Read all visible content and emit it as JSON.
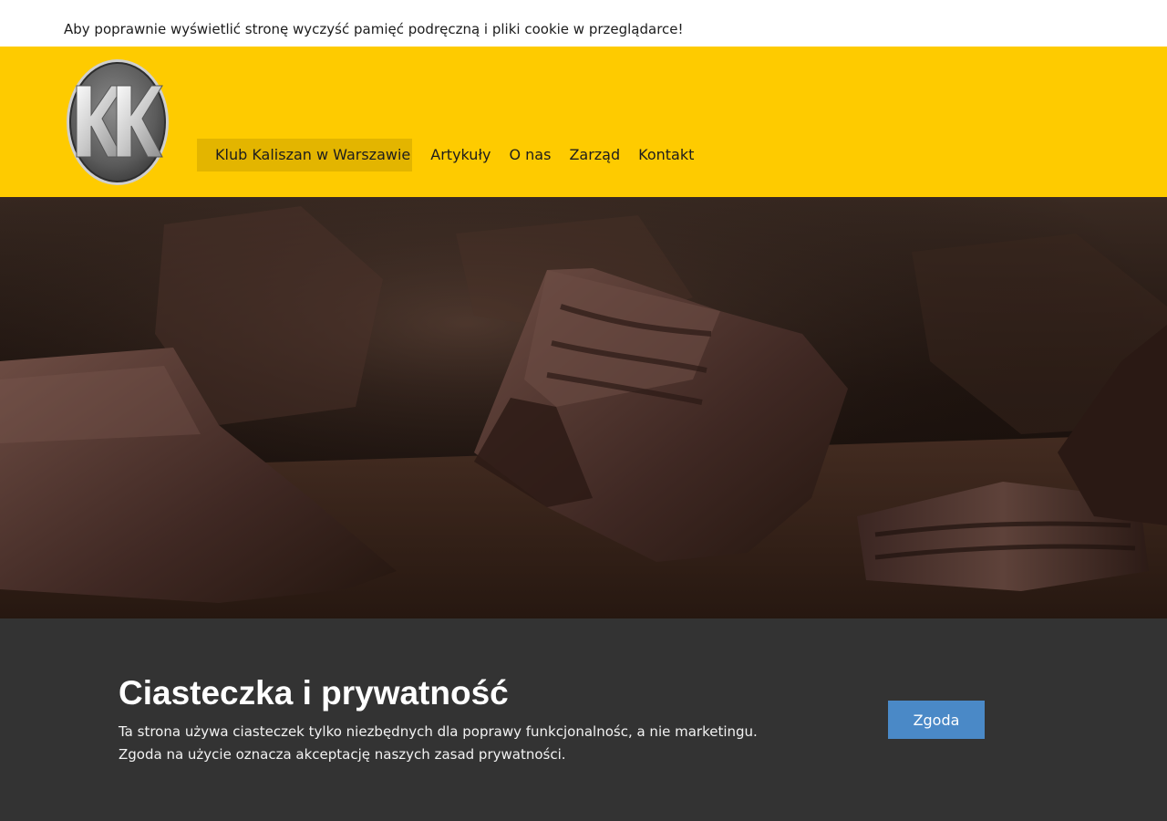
{
  "notice": {
    "text": "Aby poprawnie wyświetlić stronę wyczyść pamięć podręczną i pliki cookie w przeglądarce!"
  },
  "header": {
    "logo_icon": "kk-monogram-logo-icon",
    "nav": [
      {
        "label": "Klub Kaliszan w Warszawie",
        "active": true
      },
      {
        "label": "Artykuły",
        "active": false
      },
      {
        "label": "O nas",
        "active": false
      },
      {
        "label": "Zarząd",
        "active": false
      },
      {
        "label": "Kontakt",
        "active": false
      }
    ]
  },
  "cookie_banner": {
    "title": "Ciasteczka i prywatność",
    "line1": "Ta strona używa ciasteczek tylko niezbędnych dla poprawy funkcjonalnośc, a nie marketingu.",
    "line2": "Zgoda na użycie oznacza akceptację naszych zasad prywatności.",
    "agree_label": "Zgoda"
  },
  "colors": {
    "header_bg": "#fecb00",
    "nav_active_bg": "#e3b500",
    "cookie_bg": "#333333",
    "button_bg": "#4a89c7"
  }
}
